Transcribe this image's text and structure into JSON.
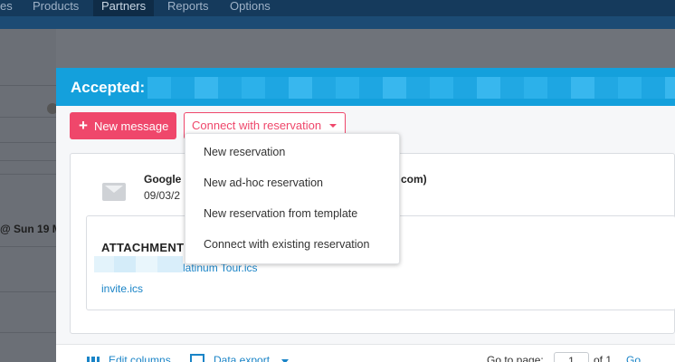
{
  "topnav": {
    "items": [
      {
        "label": "es"
      },
      {
        "label": "Products"
      },
      {
        "label": "Partners"
      },
      {
        "label": "Reports"
      },
      {
        "label": "Options"
      }
    ],
    "active": "Partners"
  },
  "background": {
    "date_text": "@ Sun 19 M"
  },
  "modal": {
    "title": "Accepted:",
    "toolbar": {
      "new_message_plus": "+",
      "new_message_label": "New message",
      "connect_label": "Connect with reservation"
    },
    "message": {
      "sender_name": "Google",
      "sender_tail": "com)",
      "date": "09/03/2"
    },
    "attachments": {
      "title": "ATTACHMENT",
      "files": [
        {
          "name": "latinum Tour.ics"
        },
        {
          "name": "invite.ics"
        }
      ]
    },
    "footer": {
      "edit_columns": "Edit columns",
      "data_export": "Data export",
      "go_to_page_label": "Go to page:",
      "page_value": "1",
      "of_total": "of 1",
      "go_label": "Go"
    }
  },
  "dropdown": {
    "items": [
      {
        "label": "New reservation"
      },
      {
        "label": "New ad-hoc reservation"
      },
      {
        "label": "New reservation from template"
      },
      {
        "label": "Connect with existing reservation"
      }
    ]
  },
  "colors": {
    "header_blue": "#14a0dc",
    "accent_pink": "#ef476b",
    "link_blue": "#1a84c7",
    "nav_dark": "#153a5c"
  },
  "icons": [
    "envelope-icon",
    "columns-icon",
    "export-icon",
    "chevron-down-icon",
    "help-icon",
    "plus-icon"
  ]
}
